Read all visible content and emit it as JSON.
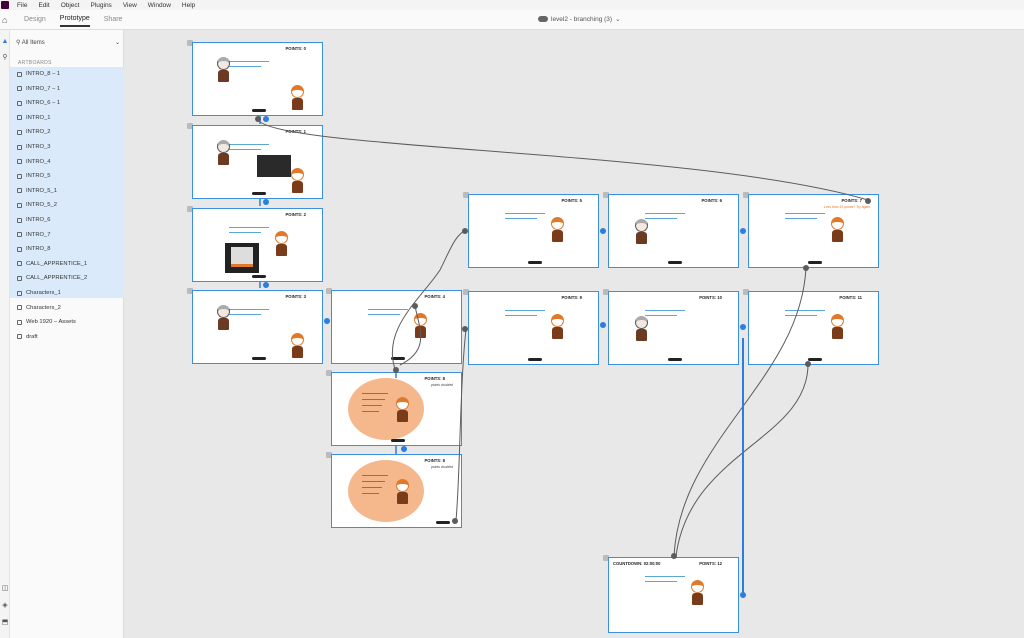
{
  "menu": [
    "File",
    "Edit",
    "Object",
    "Plugins",
    "View",
    "Window",
    "Help"
  ],
  "modes": [
    {
      "label": "Design",
      "active": false
    },
    {
      "label": "Prototype",
      "active": true
    },
    {
      "label": "Share",
      "active": false
    }
  ],
  "document_title": "level2 - branching (3)",
  "layers": {
    "filter": "All Items",
    "section": "ARTBOARDS",
    "items": [
      "INTRO_8 – 1",
      "INTRO_7 – 1",
      "INTRO_6 – 1",
      "INTRO_1",
      "INTRO_2",
      "INTRO_3",
      "INTRO_4",
      "INTRO_5",
      "INTRO_5_1",
      "INTRO_5_2",
      "INTRO_6",
      "INTRO_7",
      "INTRO_8",
      "CALL_APPRENTICE_1",
      "CALL_APPRENTICE_2",
      "Characters_1",
      "Characters_2",
      "Web 1920 – Assets",
      "draft"
    ]
  },
  "artboards": {
    "a0": {
      "points": "POINTS: 0"
    },
    "a1": {
      "points": "POINTS: 1"
    },
    "a2": {
      "points": "POINTS: 2"
    },
    "a3": {
      "points": "POINTS: 3"
    },
    "a4": {
      "points": "POINTS: 4"
    },
    "a5": {
      "points": "POINTS: 5"
    },
    "a6": {
      "points": "POINTS: 6"
    },
    "a7": {
      "points": "POINTS: 7",
      "sub": "Less than 15 points? Try again"
    },
    "a8": {
      "points": "POINTS: 8",
      "sub": "points doubled"
    },
    "a9": {
      "points": "POINTS: 9"
    },
    "a10": {
      "points": "POINTS: 10"
    },
    "a11": {
      "points": "POINTS: 11"
    },
    "a12": {
      "points": "POINTS: 12",
      "countdown": "COUNTDOWN: 02:00:00"
    },
    "a8b": {
      "points": "POINTS: 8",
      "sub": "points doubled"
    }
  },
  "colors": {
    "accent_blue": "#2b7de0",
    "wire_gray": "#5c5c5c",
    "bubble": "#f5b88d",
    "character_orange": "#e07a2a",
    "character_brown": "#7a3b1a",
    "selection": "#dbeafa"
  },
  "icons": [
    "home-icon",
    "select-icon",
    "zoom-icon",
    "cloud-icon",
    "chevron-down-icon",
    "search-icon",
    "artboard-icon"
  ]
}
